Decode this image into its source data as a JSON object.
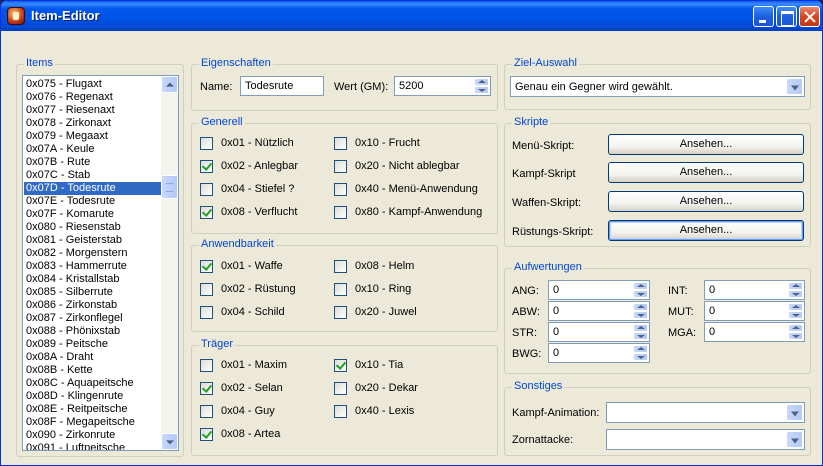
{
  "window": {
    "title": "Item-Editor"
  },
  "items": {
    "label": "Items",
    "list": [
      "0x075 - Flugaxt",
      "0x076 - Regenaxt",
      "0x077 - Riesenaxt",
      "0x078 - Zirkonaxt",
      "0x079 - Megaaxt",
      "0x07A - Keule",
      "0x07B - Rute",
      "0x07C - Stab",
      "0x07D - Todesrute",
      "0x07E - Todesrute",
      "0x07F - Komarute",
      "0x080 - Riesenstab",
      "0x081 - Geisterstab",
      "0x082 - Morgenstern",
      "0x083 - Hammerrute",
      "0x084 - Kristallstab",
      "0x085 - Silberrute",
      "0x086 - Zirkonstab",
      "0x087 - Zirkonflegel",
      "0x088 - Phönixstab",
      "0x089 - Peitsche",
      "0x08A - Draht",
      "0x08B - Kette",
      "0x08C - Aquapeitsche",
      "0x08D - Klingenrute",
      "0x08E - Reitpeitsche",
      "0x08F - Megapeitsche",
      "0x090 - Zirkonrute",
      "0x091 - Luftpeitsche"
    ],
    "selected": "0x07D - Todesrute"
  },
  "eigenschaften": {
    "label": "Eigenschaften",
    "name_label": "Name:",
    "name_value": "Todesrute",
    "wert_label": "Wert (GM):",
    "wert_value": "5200"
  },
  "generell": {
    "label": "Generell",
    "options": [
      {
        "label": "0x01 - Nützlich",
        "checked": false
      },
      {
        "label": "0x02 - Anlegbar",
        "checked": true
      },
      {
        "label": "0x04 - Stiefel ?",
        "checked": false
      },
      {
        "label": "0x08 - Verflucht",
        "checked": true
      },
      {
        "label": "0x10 - Frucht",
        "checked": false
      },
      {
        "label": "0x20 - Nicht ablegbar",
        "checked": false
      },
      {
        "label": "0x40 - Menü-Anwendung",
        "checked": false
      },
      {
        "label": "0x80 - Kampf-Anwendung",
        "checked": false
      }
    ]
  },
  "anwendbarkeit": {
    "label": "Anwendbarkeit",
    "options": [
      {
        "label": "0x01 - Waffe",
        "checked": true
      },
      {
        "label": "0x02 - Rüstung",
        "checked": false
      },
      {
        "label": "0x04 - Schild",
        "checked": false
      },
      {
        "label": "0x08 - Helm",
        "checked": false
      },
      {
        "label": "0x10 - Ring",
        "checked": false
      },
      {
        "label": "0x20 - Juwel",
        "checked": false
      }
    ]
  },
  "traeger": {
    "label": "Träger",
    "options": [
      {
        "label": "0x01 - Maxim",
        "checked": false
      },
      {
        "label": "0x02 - Selan",
        "checked": true
      },
      {
        "label": "0x04 - Guy",
        "checked": false
      },
      {
        "label": "0x08 - Artea",
        "checked": true
      },
      {
        "label": "0x10 - Tia",
        "checked": true
      },
      {
        "label": "0x20 - Dekar",
        "checked": false
      },
      {
        "label": "0x40 - Lexis",
        "checked": false
      }
    ]
  },
  "ziel_auswahl": {
    "label": "Ziel-Auswahl",
    "value": "Genau ein Gegner wird gewählt."
  },
  "skripte": {
    "label": "Skripte",
    "rows": [
      {
        "label": "Menü-Skript:",
        "button": "Ansehen..."
      },
      {
        "label": "Kampf-Skript",
        "button": "Ansehen..."
      },
      {
        "label": "Waffen-Skript:",
        "button": "Ansehen..."
      },
      {
        "label": "Rüstungs-Skript:",
        "button": "Ansehen..."
      }
    ]
  },
  "aufwertungen": {
    "label": "Aufwertungen",
    "left": [
      {
        "label": "ANG:",
        "value": "0"
      },
      {
        "label": "ABW:",
        "value": "0"
      },
      {
        "label": "STR:",
        "value": "0"
      },
      {
        "label": "BWG:",
        "value": "0"
      }
    ],
    "right": [
      {
        "label": "INT:",
        "value": "0"
      },
      {
        "label": "MUT:",
        "value": "0"
      },
      {
        "label": "MGA:",
        "value": "0"
      }
    ]
  },
  "sonstiges": {
    "label": "Sonstiges",
    "kampf_animation_label": "Kampf-Animation:",
    "kampf_animation_value": "",
    "zornattacke_label": "Zornattacke:",
    "zornattacke_value": ""
  }
}
